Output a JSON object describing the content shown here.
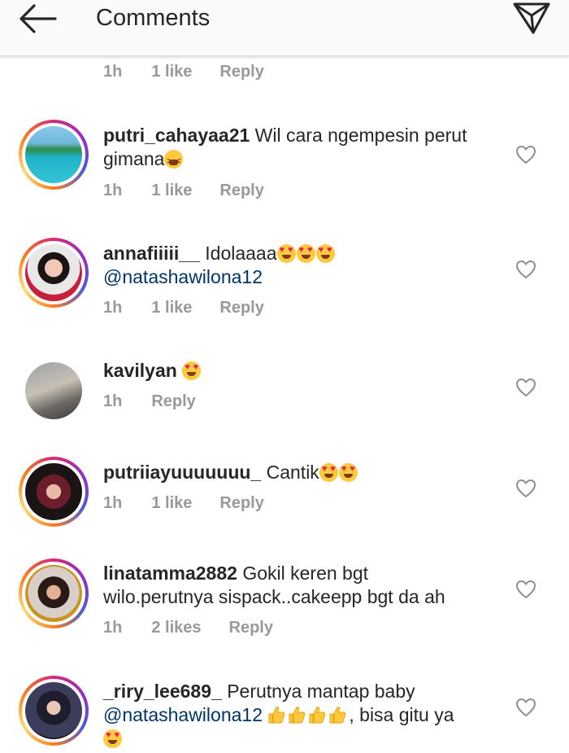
{
  "header": {
    "title": "Comments"
  },
  "top_meta": {
    "time": "1h",
    "likes": "1 like",
    "reply": "Reply"
  },
  "comments": [
    {
      "username": "putri_cahayaa21",
      "text_1": "Wil cara ngempesin perut",
      "text_2": "gimana",
      "time": "1h",
      "likes": "1 like",
      "reply": "Reply"
    },
    {
      "username": "annafiiiii__",
      "text_1": "Idolaaaa",
      "mention": "@natashawilona12",
      "time": "1h",
      "likes": "1 like",
      "reply": "Reply"
    },
    {
      "username": "kavilyan",
      "time": "1h",
      "reply": "Reply"
    },
    {
      "username": "putriiayuuuuuuu_",
      "text_1": "Cantik",
      "time": "1h",
      "likes": "1 like",
      "reply": "Reply"
    },
    {
      "username": "linatamma2882",
      "text_1": "Gokil keren bgt",
      "text_2": "wilo.perutnya sispack..cakeepp bgt da ah",
      "time": "1h",
      "likes": "2 likes",
      "reply": "Reply"
    },
    {
      "username": "_riry_lee689_",
      "text_1": "Perutnya mantap baby",
      "mention": "@natashawilona12",
      "text_2": ", bisa gitu ya"
    }
  ],
  "icons": {
    "back": "arrow-left-icon",
    "send": "paper-plane-icon",
    "like": "heart-outline-icon"
  },
  "colors": {
    "mention": "#003569",
    "meta_gray": "#999999",
    "story_ring": "#d62976"
  }
}
